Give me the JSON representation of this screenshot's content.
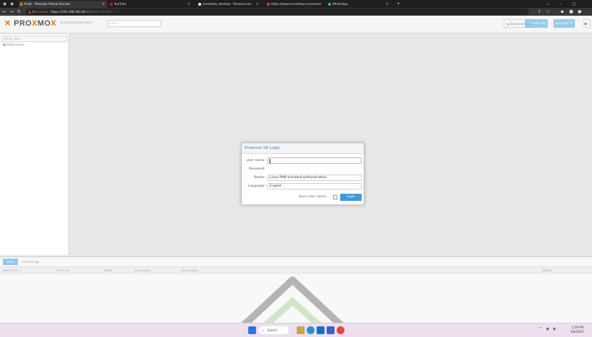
{
  "browser": {
    "tabs": [
      {
        "label": "Prodi · Proxmox Virtual Environ",
        "active": true,
        "color": "#e57000"
      },
      {
        "label": "YouTube",
        "active": false,
        "color": "#ff0000"
      },
      {
        "label": "mendeley desktop - Penelusuran",
        "active": false,
        "color": "#ffffff"
      },
      {
        "label": "https://www.mendeley.com/auto",
        "active": false,
        "color": "#d4363b"
      },
      {
        "label": "WhatsApp",
        "active": false,
        "color": "#25d366"
      }
    ],
    "new_tab": "+",
    "address": {
      "warning": "Not secure",
      "url_host": "https://192.168.200.40",
      "url_rest": ":8006/#v1:0:18:4:::::::"
    }
  },
  "header": {
    "logo_main": "PRO",
    "logo_x": "X",
    "logo_tail": "MO",
    "logo_x2": "X",
    "subtitle": "Virtual Environment",
    "search_placeholder": "Search",
    "docs": "Documentation",
    "create_vm": "Create VM",
    "create_ct": "Create CT"
  },
  "tree": {
    "view": "Server View",
    "root": "Datacenter"
  },
  "bottom": {
    "tabs": [
      "Tasks",
      "Cluster log"
    ],
    "columns": [
      "Start Time ↓",
      "End Time",
      "Node",
      "User name",
      "Description",
      "Status"
    ]
  },
  "login": {
    "title": "Proxmox VE Login",
    "username_label": "User name:",
    "password_label": "Password:",
    "realm_label": "Realm:",
    "realm_value": "Linux PAM standard authentication",
    "language_label": "Language:",
    "language_value": "English",
    "save_label": "Save User name:",
    "login_button": "Login"
  },
  "taskbar": {
    "search": "Search",
    "time": "2:59 PM",
    "date": "3/8/2023"
  }
}
